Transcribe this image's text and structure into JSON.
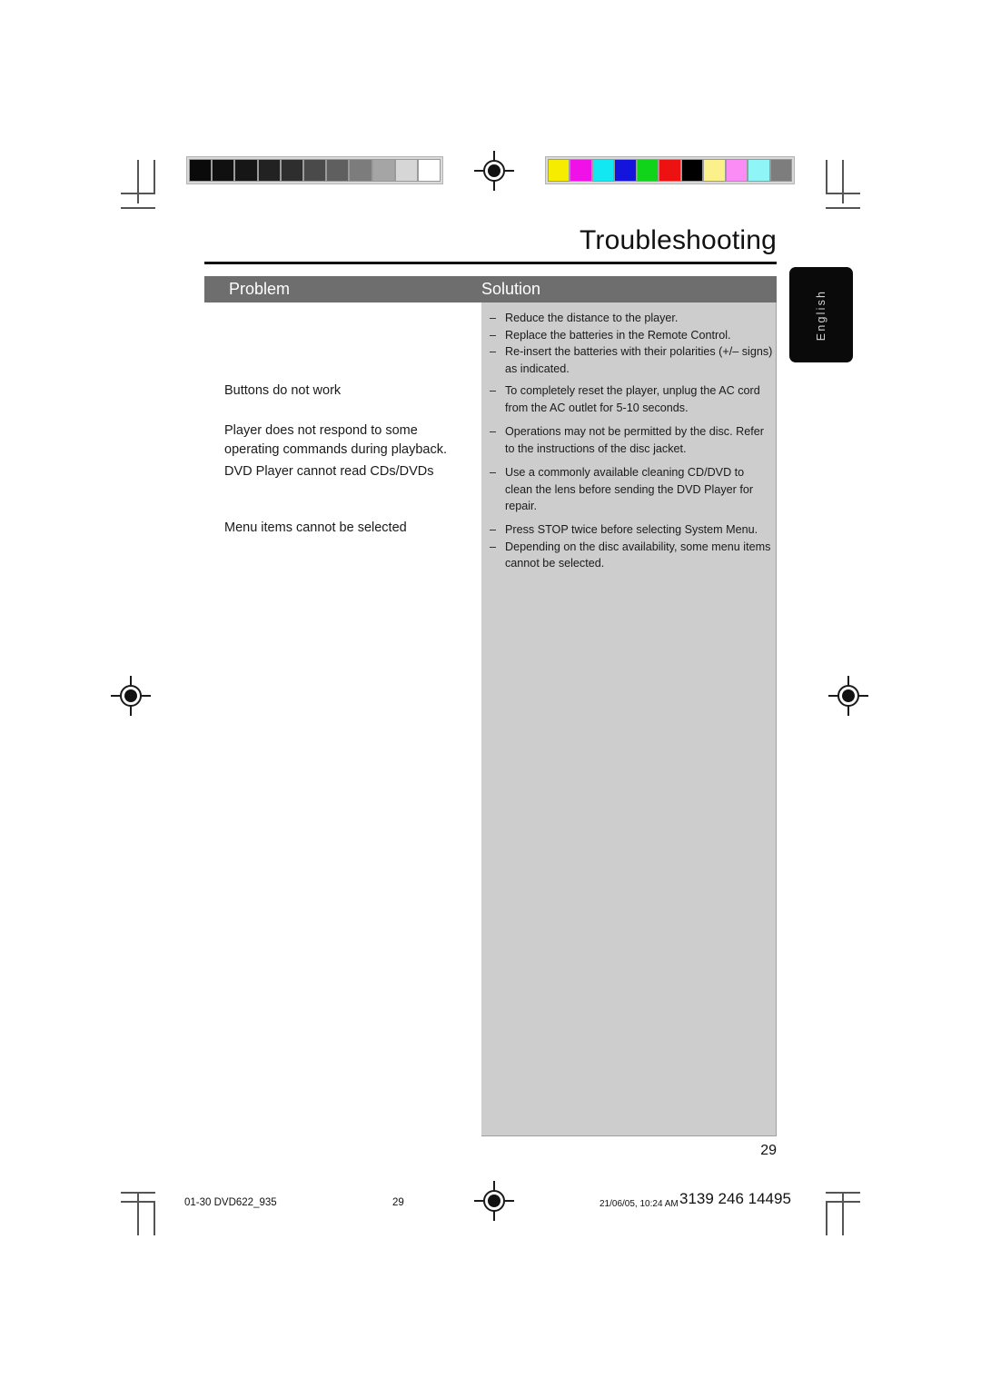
{
  "document": {
    "title": "Troubleshooting",
    "page_number": "29",
    "language_tab": "English"
  },
  "table": {
    "headers": {
      "problem": "Problem",
      "solution": "Solution"
    },
    "problems": [
      {
        "text": "Buttons do not work"
      },
      {
        "text": "Player does not respond to some operating commands during playback."
      },
      {
        "text": "DVD Player cannot read CDs/DVDs"
      },
      {
        "text": "Menu items cannot be selected"
      }
    ],
    "solution_groups": [
      {
        "items": [
          "Reduce the distance to the player.",
          "Replace the batteries in the Remote Control.",
          "Re-insert the batteries with their polarities (+/– signs) as indicated."
        ]
      },
      {
        "items": [
          "To completely reset the player, unplug the AC cord from the AC outlet for 5-10 seconds."
        ]
      },
      {
        "items": [
          "Operations may not be permitted by the disc. Refer to the instructions of  the disc jacket."
        ]
      },
      {
        "items": [
          "Use a commonly available cleaning CD/DVD to clean the lens before sending the DVD Player for repair."
        ]
      },
      {
        "items": [
          "Press STOP twice before selecting System Menu.",
          "Depending on the disc availability, some menu items cannot be selected."
        ]
      }
    ],
    "bullet_dash": "–"
  },
  "footer": {
    "filename": "01-30 DVD622_935",
    "page_number": "29",
    "timestamp": "21/06/05, 10:24 AM",
    "document_number": "3139 246 14495"
  },
  "calibration": {
    "grayscale_label": "grayscale-calibration-bar",
    "color_label": "color-calibration-bar",
    "grayscale_patches": [
      "#0a0a0a",
      "#101010",
      "#161616",
      "#222222",
      "#2e2e2e",
      "#4a4a4a",
      "#5f5f5f",
      "#7c7c7c",
      "#a5a5a5",
      "#d6d6d6",
      "#ffffff"
    ],
    "color_patches": [
      "#f6ec00",
      "#f010e8",
      "#12e8f2",
      "#1414dd",
      "#0fd419",
      "#ed1111",
      "#000000",
      "#fbf089",
      "#fb8cf5",
      "#8ff5f7",
      "#7d7d7d"
    ]
  }
}
